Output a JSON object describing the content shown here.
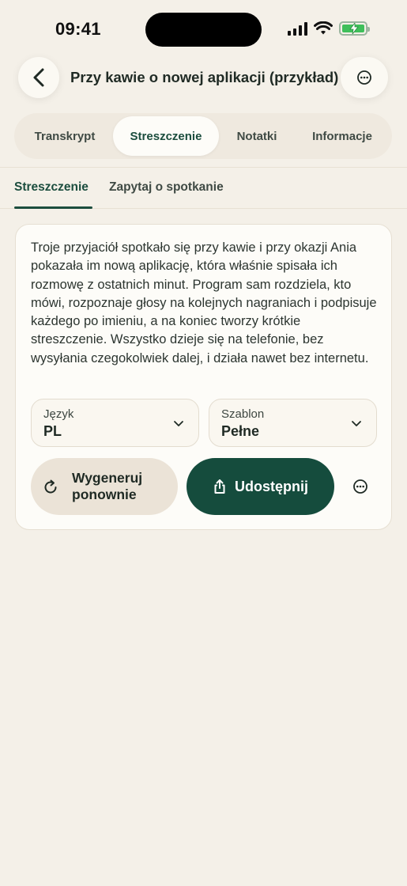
{
  "status_bar": {
    "time": "09:41",
    "icons": [
      "signal-icon",
      "wifi-icon",
      "battery-charging-icon"
    ],
    "battery_color": "#3fbf5a"
  },
  "header": {
    "back_icon": "chevron-left-icon",
    "title": "Przy kawie o nowej aplikacji (przykład)",
    "more_icon": "more-horizontal-circle-icon"
  },
  "tabs": [
    {
      "label": "Transkrypt",
      "active": false
    },
    {
      "label": "Streszczenie",
      "active": true
    },
    {
      "label": "Notatki",
      "active": false
    },
    {
      "label": "Informacje",
      "active": false
    }
  ],
  "subtabs": [
    {
      "label": "Streszczenie",
      "active": true
    },
    {
      "label": "Zapytaj o spotkanie",
      "active": false
    }
  ],
  "summary": {
    "text": "Troje przyjaciół spotkało się przy kawie i przy okazji Ania pokazała im nową aplikację, która właśnie spisała ich rozmowę z ostatnich minut. Program sam rozdziela, kto mówi, rozpoznaje głosy na kolejnych nagraniach i podpisuje każdego po imieniu, a na koniec tworzy krótkie streszczenie. Wszystko dzieje się na telefonie, bez wysyłania czegokolwiek dalej, i działa nawet bez internetu."
  },
  "selects": {
    "language": {
      "label": "Język",
      "value": "PL"
    },
    "template": {
      "label": "Szablon",
      "value": "Pełne"
    }
  },
  "actions": {
    "regenerate_label": "Wygeneruj ponownie",
    "share_label": "Udostępnij",
    "more_icon": "more-horizontal-circle-icon"
  },
  "colors": {
    "background": "#f4f0e8",
    "accent": "#154c3d",
    "card": "#fdfcf8"
  }
}
